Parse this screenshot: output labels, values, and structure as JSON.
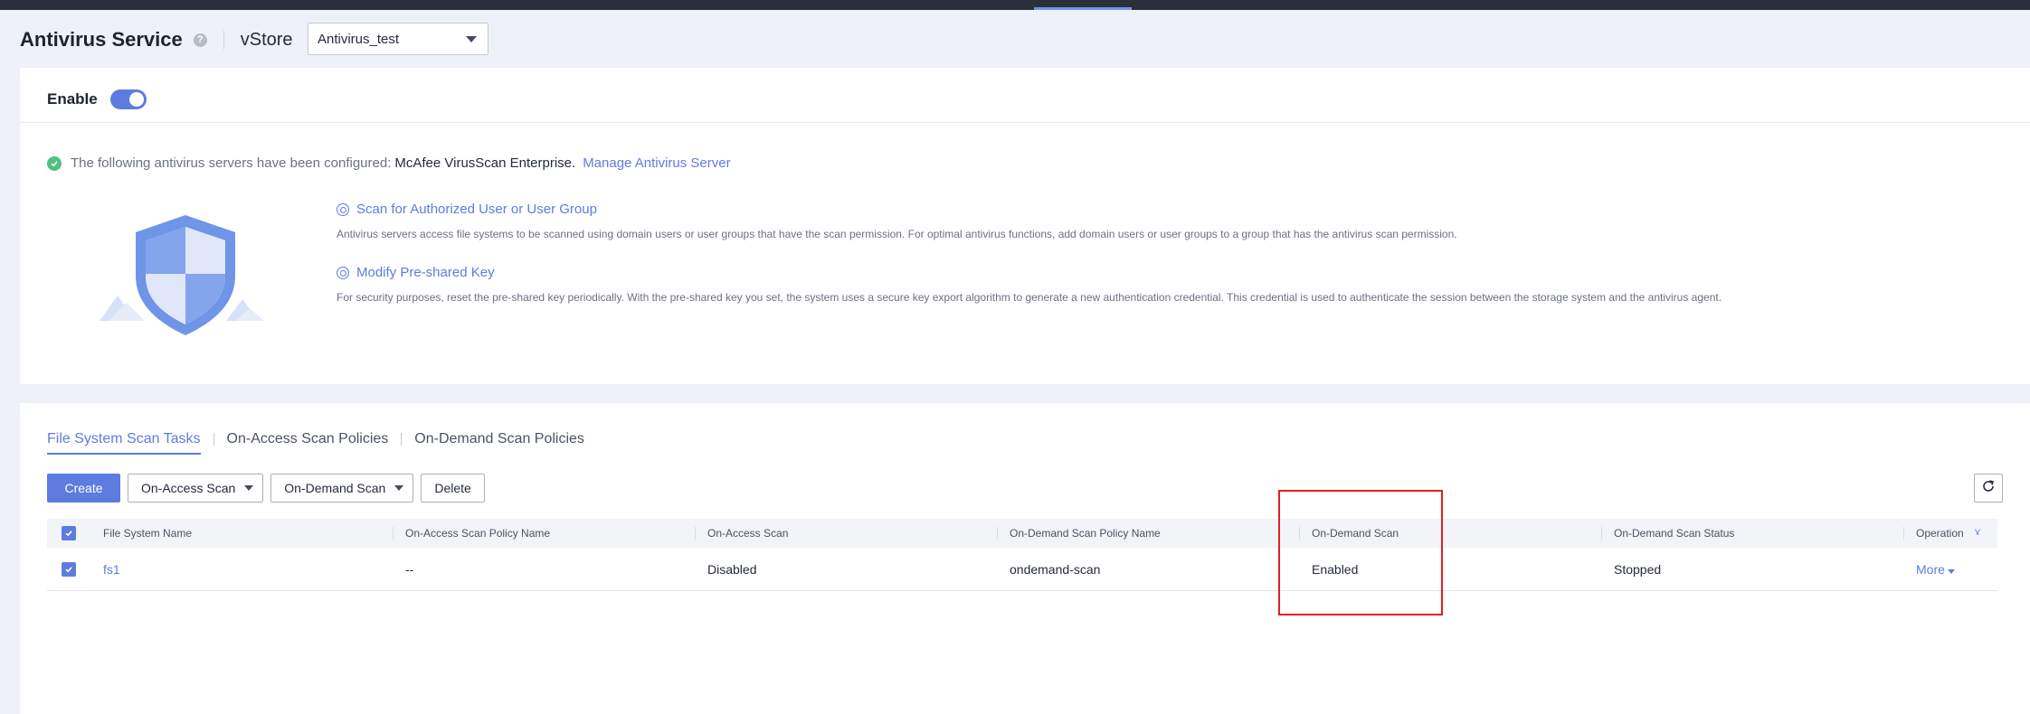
{
  "header": {
    "title": "Antivirus Service",
    "help_icon": "question-icon",
    "vstore_label": "vStore",
    "vstore_selected": "Antivirus_test"
  },
  "enable": {
    "label": "Enable",
    "state": true
  },
  "info": {
    "prefix": "The following antivirus servers have been configured:",
    "server_name": "McAfee VirusScan Enterprise.",
    "manage_link": "Manage Antivirus Server"
  },
  "tips": [
    {
      "title": "Scan for Authorized User or User Group",
      "description": "Antivirus servers access file systems to be scanned using domain users or user groups that have the scan permission. For optimal antivirus functions, add domain users or user groups to a group that has the antivirus scan permission."
    },
    {
      "title": "Modify Pre-shared Key",
      "description": "For security purposes, reset the pre-shared key periodically. With the pre-shared key you set, the system uses a secure key export algorithm to generate a new authentication credential. This credential is used to authenticate the session between the storage system and the antivirus agent."
    }
  ],
  "tabs": [
    "File System Scan Tasks",
    "On-Access Scan Policies",
    "On-Demand Scan Policies"
  ],
  "toolbar": {
    "create": "Create",
    "on_access": "On-Access Scan",
    "on_demand": "On-Demand Scan",
    "delete": "Delete",
    "refresh_icon": "refresh-icon"
  },
  "table": {
    "columns": [
      "File System Name",
      "On-Access Scan Policy Name",
      "On-Access Scan",
      "On-Demand Scan Policy Name",
      "On-Demand Scan",
      "On-Demand Scan Status",
      "Operation"
    ],
    "rows": [
      {
        "checked": true,
        "fs_name": "fs1",
        "on_access_policy": "--",
        "on_access_scan": "Disabled",
        "on_demand_policy": "ondemand-scan",
        "on_demand_scan": "Enabled",
        "on_demand_status": "Stopped",
        "operation": "More"
      }
    ]
  },
  "colors": {
    "accent": "#5e7ce0",
    "success": "#50c080",
    "highlight": "#e02020"
  }
}
